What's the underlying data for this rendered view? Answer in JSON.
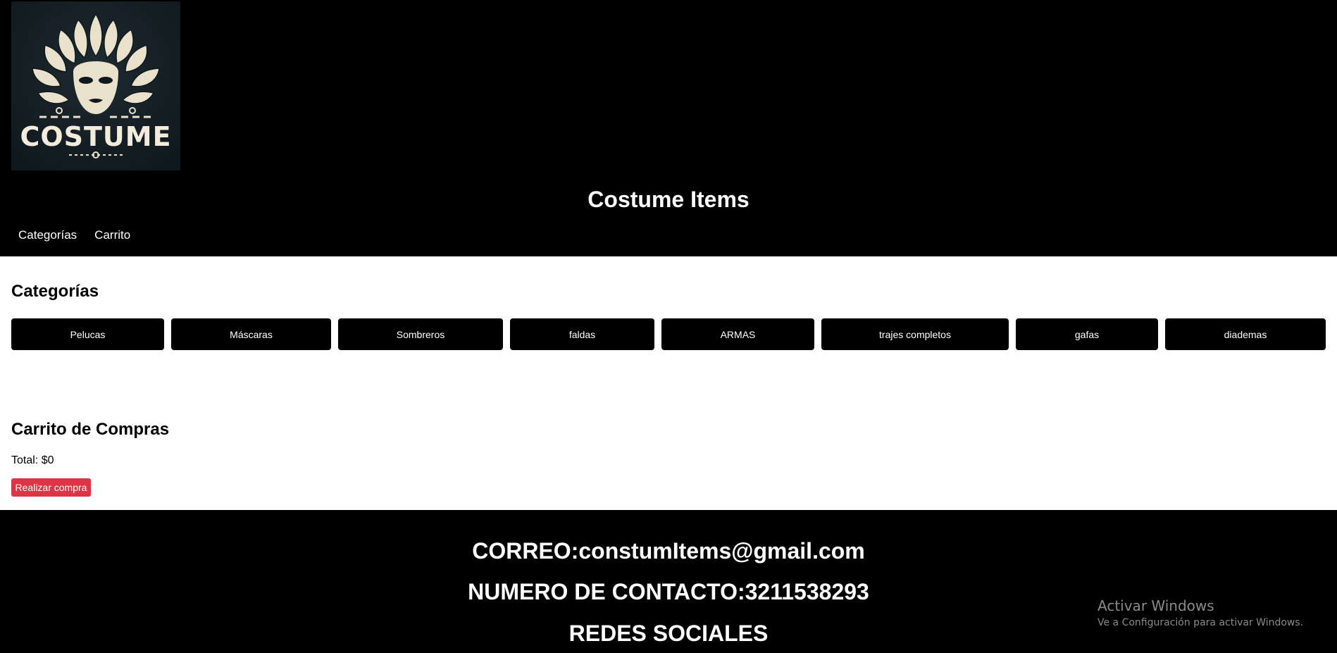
{
  "header": {
    "logo_text": "COSTUME",
    "title": "Costume Items",
    "nav": [
      {
        "label": "Categorías"
      },
      {
        "label": "Carrito"
      }
    ]
  },
  "categories": {
    "heading": "Categorías",
    "items": [
      "Pelucas",
      "Máscaras",
      "Sombreros",
      "faldas",
      "ARMAS",
      "trajes completos",
      "gafas",
      "diademas"
    ]
  },
  "cart": {
    "heading": "Carrito de Compras",
    "total": "Total: $0",
    "buy_label": "Realizar compra"
  },
  "footer": {
    "email": "CORREO:constumItems@gmail.com",
    "phone": "NUMERO DE CONTACTO:3211538293",
    "social": "REDES SOCIALES"
  },
  "watermark": {
    "title": "Activar Windows",
    "subtitle": "Ve a Configuración para activar Windows."
  },
  "colors": {
    "header_bg": "#000000",
    "button_bg": "#000000",
    "buy_button": "#dc3545"
  }
}
